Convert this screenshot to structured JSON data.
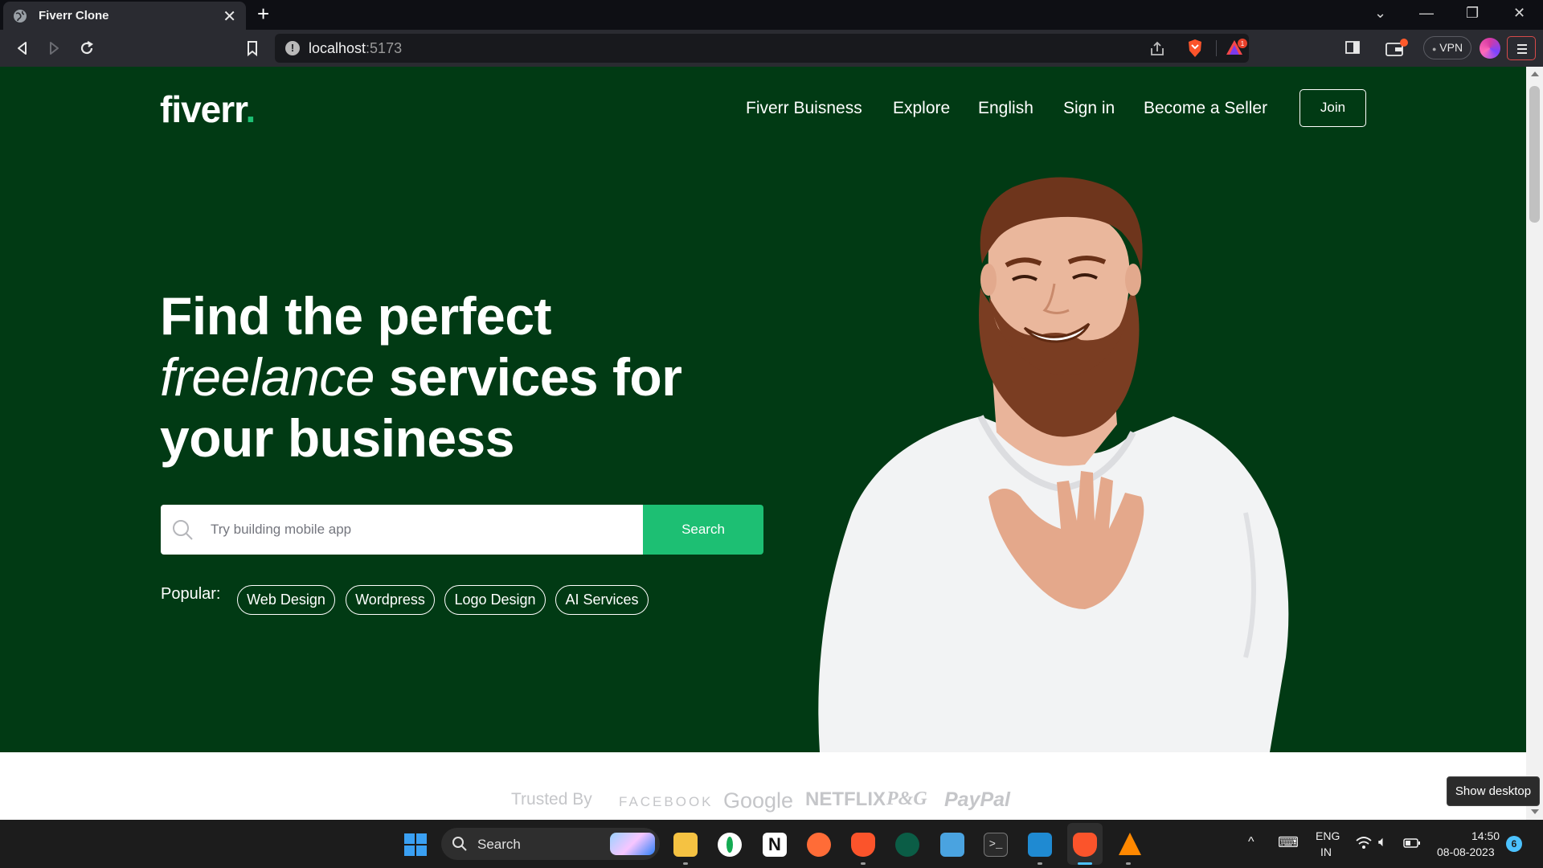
{
  "browser": {
    "tab_title": "Fiverr Clone",
    "url_host": "localhost",
    "url_port": ":5173",
    "vpn_label": "VPN",
    "notification_count": "1"
  },
  "nav": {
    "logo": "fiverr",
    "logo_dot": ".",
    "links": [
      "Fiverr Buisness",
      "Explore",
      "English",
      "Sign in",
      "Become a Seller"
    ],
    "join_label": "Join"
  },
  "hero": {
    "headline_1": "Find the perfect",
    "headline_2_italic": "freelance",
    "headline_2_rest": " services for",
    "headline_3": "your business",
    "search_placeholder": "Try building mobile app",
    "search_button": "Search",
    "popular_label": "Popular:",
    "popular_tags": [
      "Web Design",
      "Wordpress",
      "Logo Design",
      "AI Services"
    ]
  },
  "trusted": {
    "label": "Trusted By",
    "brands": [
      "FACEBOOK",
      "Google",
      "NETFLIX",
      "P&G",
      "PayPal"
    ]
  },
  "tooltip": "Show desktop",
  "taskbar": {
    "search_label": "Search",
    "language_1": "ENG",
    "language_2": "IN",
    "time": "14:50",
    "date": "08-08-2023",
    "notification_badge": "6"
  },
  "colors": {
    "hero_bg": "#013a14",
    "accent_green": "#1dbf73"
  }
}
